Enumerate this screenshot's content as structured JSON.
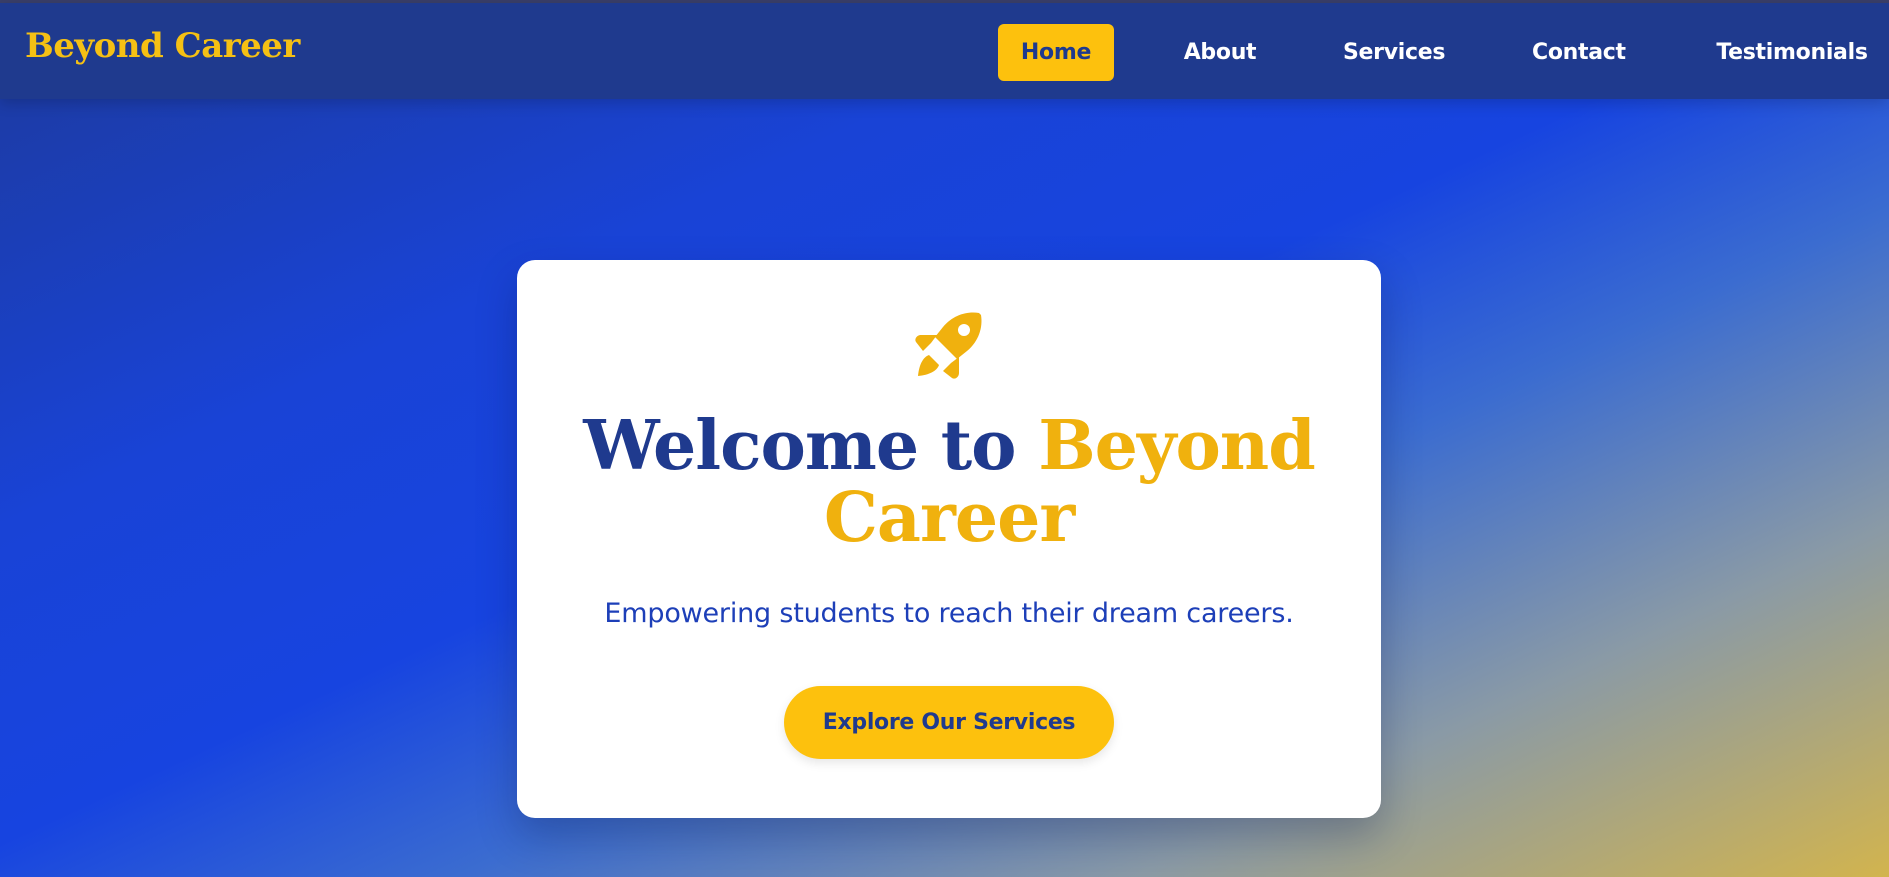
{
  "brand": {
    "name": "Beyond Career",
    "color": "#f5c014"
  },
  "nav": {
    "items": [
      {
        "label": "Home",
        "active": true
      },
      {
        "label": "About",
        "active": false
      },
      {
        "label": "Services",
        "active": false
      },
      {
        "label": "Contact",
        "active": false
      },
      {
        "label": "Testimonials",
        "active": false
      }
    ]
  },
  "hero": {
    "icon": "rocket-icon",
    "title_prefix": "Welcome to ",
    "title_accent": "Beyond Career",
    "tagline": "Empowering students to reach their dream careers.",
    "cta_label": "Explore Our Services"
  },
  "colors": {
    "navy": "#1f3a8e",
    "yellow": "#fdc10d",
    "title_accent": "#f0b10e",
    "tagline": "#1d3fb8",
    "card_bg": "#ffffff"
  }
}
